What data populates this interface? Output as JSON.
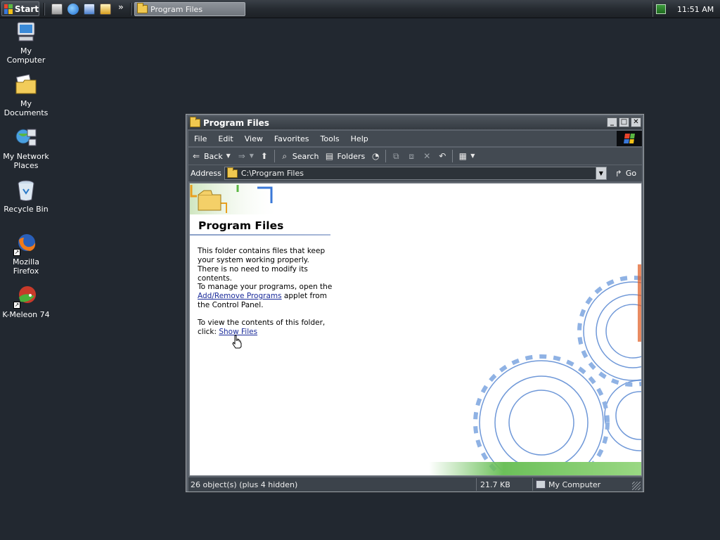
{
  "taskbar": {
    "start_label": "Start",
    "more_glyph": "»",
    "task_title": "Program Files",
    "clock": "11:51 AM",
    "quicklaunch_icons": [
      "show-desktop-icon",
      "internet-explorer-icon",
      "outlook-express-icon",
      "media-icon"
    ],
    "tray_icon": "network-icon"
  },
  "desktop": {
    "icons": [
      {
        "label": "My Computer",
        "icon": "computer-icon"
      },
      {
        "label": "My Documents",
        "icon": "documents-folder-icon"
      },
      {
        "label": "My Network Places",
        "icon": "network-places-icon"
      },
      {
        "label": "Recycle Bin",
        "icon": "recycle-bin-icon"
      },
      {
        "label": "Mozilla Firefox",
        "icon": "firefox-icon"
      },
      {
        "label": "K-Meleon 74",
        "icon": "k-meleon-icon"
      }
    ]
  },
  "window": {
    "title": "Program Files",
    "minimize_glyph": "_",
    "maximize_glyph": "□",
    "close_glyph": "✕",
    "menu": [
      "File",
      "Edit",
      "View",
      "Favorites",
      "Tools",
      "Help"
    ],
    "toolbar": {
      "back": "Back",
      "search": "Search",
      "folders": "Folders"
    },
    "address": {
      "label": "Address",
      "value": "C:\\Program Files",
      "go": "Go"
    },
    "content": {
      "heading": "Program Files",
      "para1": "This folder contains files that keep your system working properly. There is no need to modify its contents.",
      "para2_pre": "To manage your programs, open the ",
      "para2_link": "Add/Remove Programs",
      "para2_post": " applet from the Control Panel.",
      "para3_pre": "To view the contents of this folder, click: ",
      "para3_link": "Show Files"
    },
    "status": {
      "objects": "26 object(s) (plus 4 hidden)",
      "size": "21.7 KB",
      "zone": "My Computer"
    }
  },
  "colors": {
    "desktop": "#222830",
    "link": "#1a2b9a",
    "gear": "#6f98d8"
  }
}
